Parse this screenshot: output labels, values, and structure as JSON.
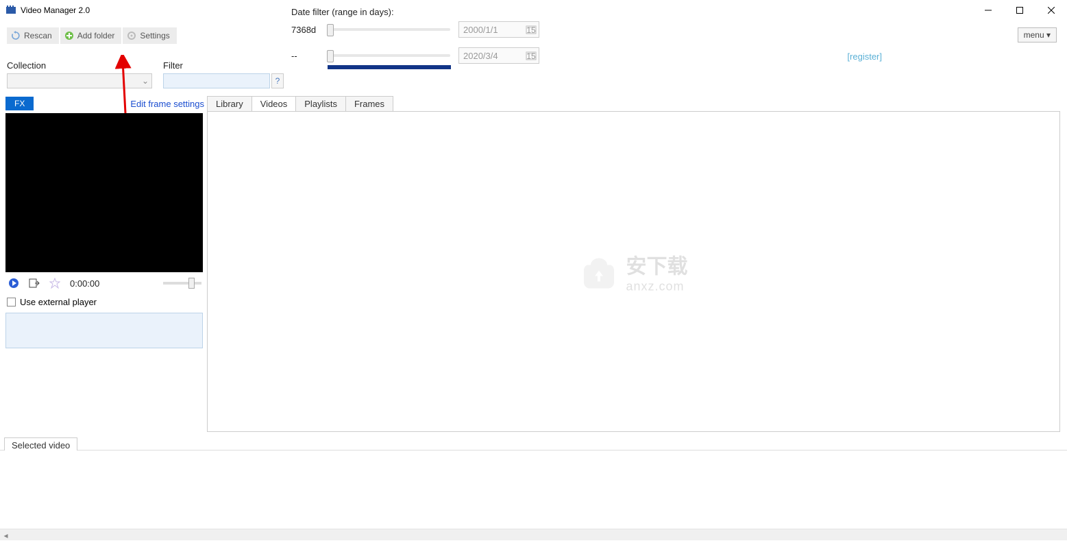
{
  "window": {
    "title": "Video Manager 2.0"
  },
  "toolbar": {
    "rescan_label": "Rescan",
    "add_folder_label": "Add folder",
    "settings_label": "Settings"
  },
  "menu_button": {
    "label": "menu ▾"
  },
  "register": {
    "label": "[register]"
  },
  "date_filter": {
    "title": "Date filter (range in days):",
    "days_label": "7368d",
    "from_value": "2000/1/1",
    "to_value": "2020/3/4",
    "dash": "--"
  },
  "collection": {
    "label": "Collection",
    "selected": ""
  },
  "filter": {
    "label": "Filter",
    "value": "",
    "help_symbol": "?"
  },
  "left_panel": {
    "fx_label": "FX",
    "edit_frame_label": "Edit frame settings",
    "time_label": "0:00:00",
    "external_player_label": "Use external player",
    "external_player_checked": false
  },
  "main_tabs": {
    "items": [
      {
        "label": "Library",
        "active": false
      },
      {
        "label": "Videos",
        "active": true
      },
      {
        "label": "Playlists",
        "active": false
      },
      {
        "label": "Frames",
        "active": false
      }
    ]
  },
  "watermark": {
    "text_cn": "安下载",
    "text_en": "anxz.com"
  },
  "bottom_tab": {
    "label": "Selected video"
  }
}
